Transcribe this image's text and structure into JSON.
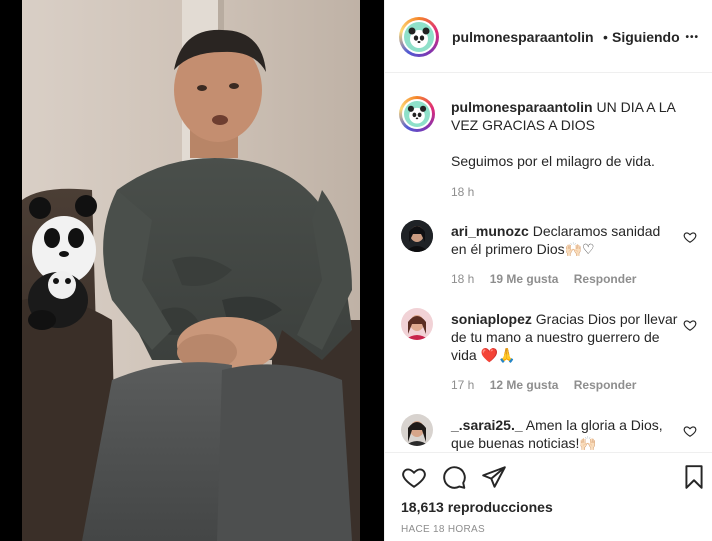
{
  "post": {
    "username": "pulmonesparaantolin",
    "follow_separator": "•",
    "follow_status": "Siguiendo",
    "more_glyph": "•••",
    "caption_line1": "UN DIA A LA VEZ GRACIAS A DIOS",
    "caption_line2": "Seguimos por el milagro de vida.",
    "caption_time": "18 h"
  },
  "comments": [
    {
      "username": "ari_munozc",
      "text": "Declaramos sanidad en él primero Dios🙌🏻♡",
      "time": "18 h",
      "likes": "19 Me gusta",
      "reply": "Responder"
    },
    {
      "username": "soniaplopez",
      "text": "Gracias Dios por llevar de tu mano a nuestro guerrero de vida ❤️🙏",
      "time": "17 h",
      "likes": "12 Me gusta",
      "reply": "Responder"
    },
    {
      "username": "_.sarai25._",
      "text": "Amen la gloria a Dios, que buenas noticias!🙌🏻"
    }
  ],
  "footer": {
    "views": "18,613 reproducciones",
    "posted_ago": "HACE 18 HORAS"
  },
  "icons": {
    "like": "heart-icon",
    "comment": "comment-icon",
    "share": "share-icon",
    "save": "bookmark-icon"
  },
  "colors": {
    "text": "#262626",
    "muted": "#8e8e8e",
    "border": "#efefef",
    "avatar_bg": "#8ee0c9"
  }
}
